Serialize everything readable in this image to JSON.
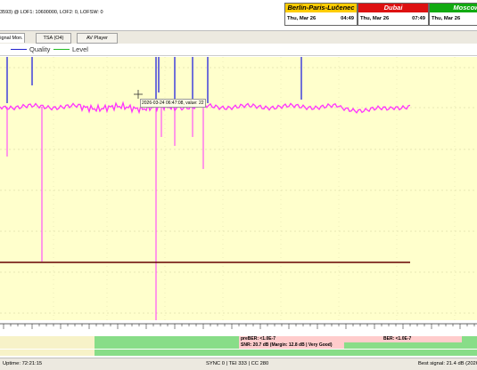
{
  "info_text": "3593) @ LOF1: 10600000, LOF2: 0, LOFSW: 0",
  "clocks": [
    {
      "city": "Berlin-Paris-Lučenec",
      "date": "Thu, Mar 26",
      "time": "04:49",
      "header_bg": "#ffcc00",
      "header_fg": "#000000"
    },
    {
      "city": "Dubai",
      "date": "Thu, Mar 26",
      "time": "07:49",
      "header_bg": "#dd1111",
      "header_fg": "#ffffff"
    },
    {
      "city": "Moscow",
      "date": "Thu, Mar 26",
      "time": "",
      "header_bg": "#11aa11",
      "header_fg": "#ffffff"
    }
  ],
  "tabs": [
    "ignal Mon.",
    "TSA (O4)",
    "AV Player"
  ],
  "legend": [
    {
      "label": "Quality",
      "color": "#2222cc"
    },
    {
      "label": "Level",
      "color": "#22bb22"
    }
  ],
  "tooltip": "2026-03-24 06:47:08, value: 22",
  "colors": {
    "plot_bg": "#ffffcc",
    "signal": "#ff33ff",
    "quality_spike": "#3333dd",
    "baseline": "#660000"
  },
  "bars": {
    "prober": "preBER: <1.0E-7",
    "ber": "BER: <1.0E-7",
    "snr": "SNR: 20.7 dB (Margin: 12.8 dB | Very Good)"
  },
  "status": {
    "uptime": "Uptime: 72:21:15",
    "sync": "SYNC 0 | TEI 333 | CC 280",
    "best": "Best signal: 21.4 dB (2026-"
  }
}
